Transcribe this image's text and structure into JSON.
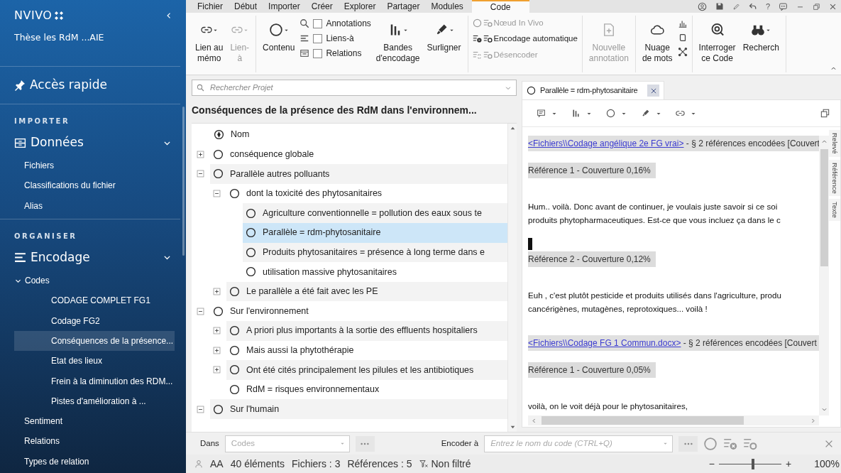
{
  "sidebar": {
    "app_name": "NVIVO",
    "project": "Thèse les RdM ...AIE",
    "quick_access": "Accès rapide",
    "sections": [
      {
        "heading": "IMPORTER",
        "groups": [
          {
            "title": "Données",
            "expanded": true,
            "items": [
              {
                "label": "Fichiers",
                "selected": false
              },
              {
                "label": "Classifications du fichier",
                "selected": false
              },
              {
                "label": "Alias",
                "selected": false
              }
            ]
          }
        ]
      },
      {
        "heading": "ORGANISER",
        "groups": [
          {
            "title": "Encodage",
            "expanded": true,
            "items": [
              {
                "label": "Codes",
                "selected": false,
                "expanded": true,
                "children": [
                  {
                    "label": "CODAGE COMPLET FG1",
                    "selected": false
                  },
                  {
                    "label": "Codage FG2",
                    "selected": false
                  },
                  {
                    "label": "Conséquences de la présence...",
                    "selected": true
                  },
                  {
                    "label": "Etat des lieux",
                    "selected": false
                  },
                  {
                    "label": "Frein à la diminution des RDM...",
                    "selected": false
                  },
                  {
                    "label": "Pistes d'amélioration à ...",
                    "selected": false
                  }
                ]
              },
              {
                "label": "Sentiment",
                "selected": false
              },
              {
                "label": "Relations",
                "selected": false
              },
              {
                "label": "Types de relation",
                "selected": false
              }
            ]
          }
        ]
      }
    ]
  },
  "menu_tabs": [
    {
      "label": "Fichier",
      "selected": false
    },
    {
      "label": "Début",
      "selected": false
    },
    {
      "label": "Importer",
      "selected": false
    },
    {
      "label": "Créer",
      "selected": false
    },
    {
      "label": "Explorer",
      "selected": false
    },
    {
      "label": "Partager",
      "selected": false
    },
    {
      "label": "Modules",
      "selected": false
    },
    {
      "label": "Code",
      "selected": true
    }
  ],
  "title_bar": {
    "help": "?"
  },
  "ribbon": {
    "groups": [
      {
        "items": [
          {
            "kind": "big",
            "lines": [
              "Lien au",
              "mémo"
            ],
            "disabled": false
          },
          {
            "kind": "big",
            "lines": [
              "Lien-",
              "à"
            ],
            "disabled": true
          }
        ]
      },
      {
        "items": [
          {
            "kind": "big",
            "lines": [
              "Contenu"
            ],
            "disabled": false
          },
          {
            "kind": "checks",
            "options": [
              {
                "label": "Annotations",
                "checked": false
              },
              {
                "label": "Liens-à",
                "checked": false
              },
              {
                "label": "Relations",
                "checked": false
              }
            ]
          },
          {
            "kind": "big",
            "lines": [
              "Bandes",
              "d'encodage"
            ],
            "disabled": false
          },
          {
            "kind": "big",
            "lines": [
              "Surligner"
            ],
            "disabled": false
          }
        ]
      },
      {
        "items": [
          {
            "kind": "list",
            "entries": [
              {
                "label": "Nœud In Vivo",
                "disabled": true
              },
              {
                "label": "Encodage automatique",
                "disabled": false
              },
              {
                "label": "Désencoder",
                "disabled": true
              }
            ]
          }
        ]
      },
      {
        "items": [
          {
            "kind": "big",
            "lines": [
              "Nouvelle",
              "annotation"
            ],
            "disabled": true
          }
        ]
      },
      {
        "items": [
          {
            "kind": "big",
            "lines": [
              "Nuage",
              "de mots"
            ],
            "disabled": false
          },
          {
            "kind": "icons"
          }
        ]
      },
      {
        "items": [
          {
            "kind": "big",
            "lines": [
              "Interroger",
              "ce Code"
            ],
            "disabled": false
          },
          {
            "kind": "big",
            "lines": [
              "Recherch"
            ],
            "disabled": false
          }
        ]
      }
    ]
  },
  "project_panel": {
    "search": {
      "placeholder": "Rechercher Projet"
    },
    "title": "Conséquences de la présence des RdM dans l'environnem...",
    "column": "Nom",
    "nodes": [
      {
        "label": "conséquence globale",
        "selected": false,
        "expanded": false
      },
      {
        "label": "Parallèle autres polluants",
        "selected": false,
        "expanded": true,
        "children": [
          {
            "label": "dont la toxicité des phytosanitaires",
            "selected": false,
            "expanded": true,
            "children": [
              {
                "label": "Agriculture conventionnelle = pollution des eaux sous te",
                "selected": false
              },
              {
                "label": "Parallèle = rdm-phytosanitaire",
                "selected": true
              },
              {
                "label": "Produits phytosanitaires = présence à long terme dans e",
                "selected": false
              },
              {
                "label": "utilisation massive phytosanitaires",
                "selected": false
              }
            ]
          },
          {
            "label": "Le parallèle a été fait avec les PE",
            "selected": false,
            "expanded": false
          }
        ]
      },
      {
        "label": "Sur l'environnement",
        "selected": false,
        "expanded": true,
        "children": [
          {
            "label": "A  priori plus importants à la sortie des effluents hospitaliers",
            "selected": false,
            "expanded": false
          },
          {
            "label": "Mais aussi la phytothérapie",
            "selected": false,
            "expanded": false
          },
          {
            "label": "Ont été cités principalement les pilules et les antibiotiques",
            "selected": false,
            "expanded": false
          },
          {
            "label": "RdM = risques environnementaux",
            "selected": false
          }
        ]
      },
      {
        "label": "Sur l'humain",
        "selected": false,
        "expanded": true
      }
    ]
  },
  "detail_panel": {
    "tab": {
      "label": "Parallèle = rdm-phytosanitaire",
      "selected": true
    },
    "content": [
      {
        "kind": "source",
        "link": "<Fichiers\\\\Codage angélique 2e FG vrai>",
        "text": " - § 2 références encodées  [Couvert"
      },
      {
        "kind": "reference",
        "text": "Référence 1 - Couverture 0,16%"
      },
      {
        "kind": "paragraph",
        "lines": [
          "Hum.. voilà. Donc avant de continuer, je voulais juste savoir si ce soi",
          "produits phytopharmaceutiques. Est-ce que vous incluez ça dans le c"
        ]
      },
      {
        "kind": "cursor"
      },
      {
        "kind": "reference",
        "text": "Référence 2 - Couverture 0,12%"
      },
      {
        "kind": "paragraph",
        "lines": [
          "Euh , c'est plutôt pesticide et produits utilisés dans l'agriculture, produ",
          "cancérigènes, mutagènes, reprotoxiques... voilà !"
        ]
      },
      {
        "kind": "source",
        "link": "<Fichiers\\\\Codage FG 1 Commun.docx>",
        "text": " - § 2 références encodées  [Couvert"
      },
      {
        "kind": "reference",
        "text": "Référence 1 - Couverture 0,05%"
      },
      {
        "kind": "paragraph",
        "lines": [
          "voilà, on le voit déjà pour le phytosanitaires,"
        ]
      }
    ],
    "side_tabs": [
      "Relevé",
      "Référence",
      "Texte"
    ]
  },
  "encode_bar": {
    "scope_label": "Dans",
    "scope": {
      "placeholder": "Codes"
    },
    "target_label": "Encoder à",
    "target": {
      "placeholder": "Entrez le nom du code (CTRL+Q)"
    }
  },
  "status_bar": {
    "user": "AA",
    "counts": [
      "40 éléments",
      "Fichiers : 3",
      "Références : 5"
    ],
    "filter": "Non filtré",
    "zoom": {
      "minus": "−",
      "plus": "+",
      "level": 0.55,
      "reading": "100%"
    }
  }
}
